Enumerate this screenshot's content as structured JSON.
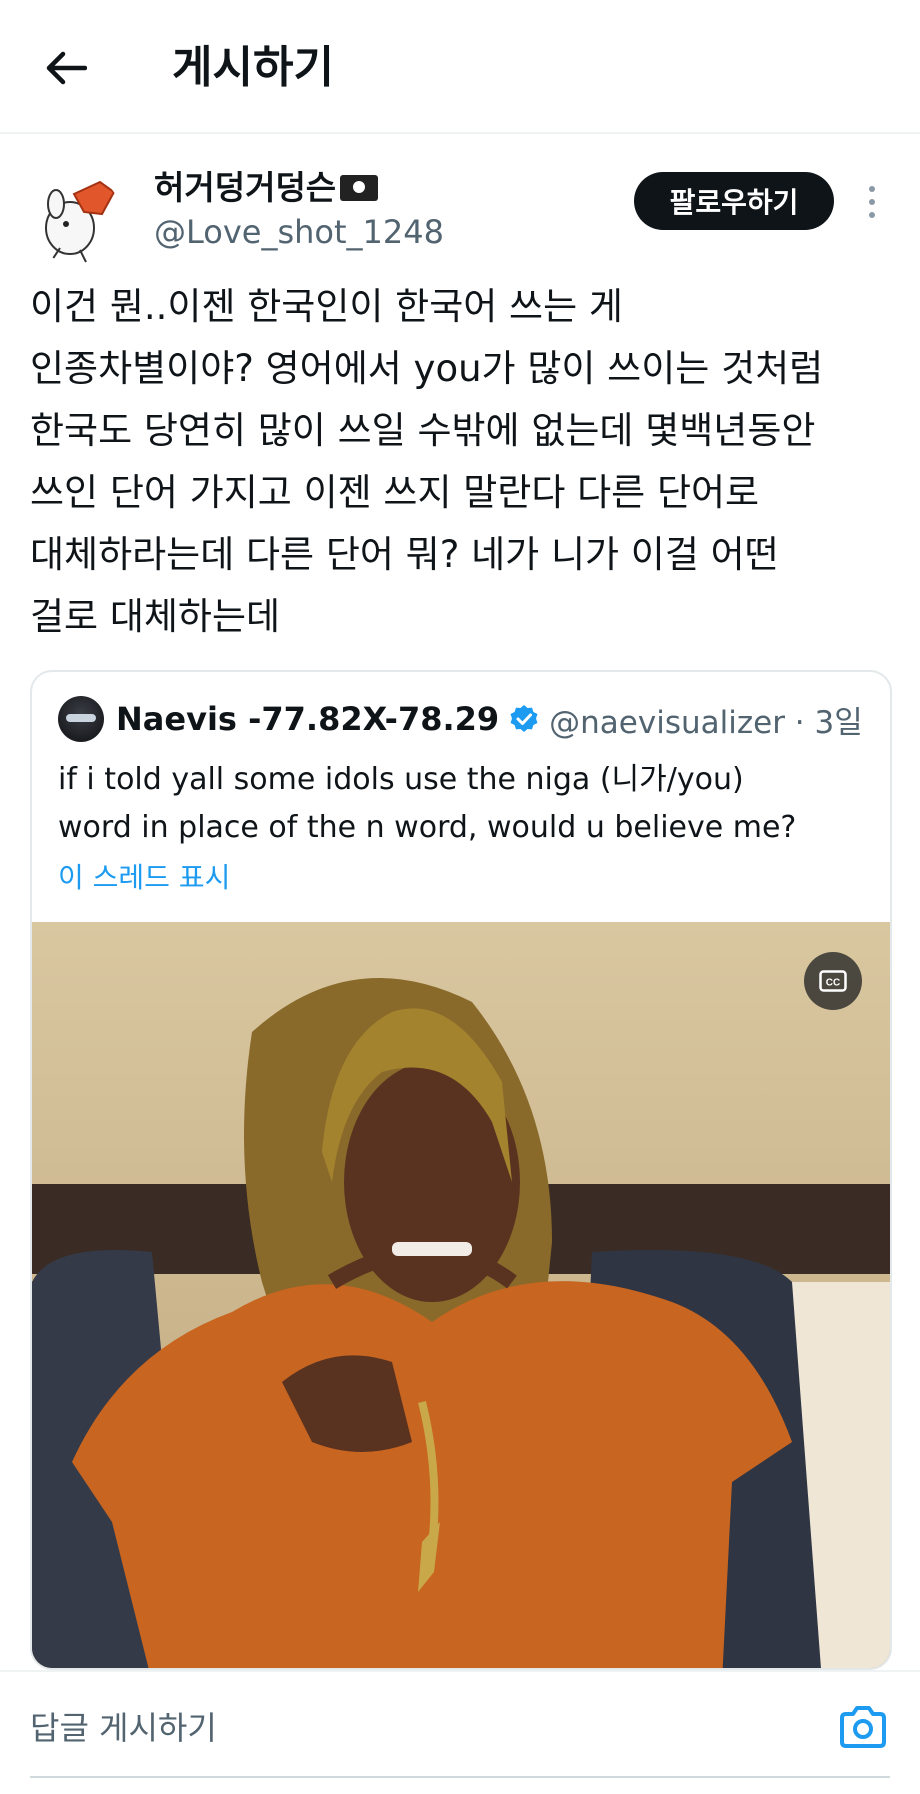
{
  "header": {
    "title": "게시하기",
    "back_icon": "arrow-left-icon"
  },
  "author": {
    "name": "허거덩거덩슨",
    "name_emoji": "pirate-flag-icon",
    "handle": "@Love_shot_1248",
    "follow_label": "팔로우하기",
    "more_icon": "more-vertical-icon"
  },
  "post": {
    "text": "이건 뭔..이젠 한국인이 한국어 쓰는 게\n인종차별이야? 영어에서 you가 많이 쓰이는 것처럼\n한국도 당연히 많이 쓰일 수밖에 없는데 몇백년동안\n쓰인 단어 가지고 이젠 쓰지 말란다 다른 단어로\n대체하라는데 다른 단어 뭐? 네가 니가 이걸 어떤\n걸로 대체하는데"
  },
  "quote": {
    "name": "Naevis -77.82X-78.29",
    "verified_icon": "verified-badge-icon",
    "handle": "@naevisualizer · 3일",
    "text": "if i told yall some idols use the niga (니가/you)\nword in place of the n word, would u believe me?",
    "thread_link": "이 스레드 표시",
    "media_cc_icon": "closed-captions-icon"
  },
  "reply": {
    "placeholder": "답글 게시하기",
    "camera_icon": "camera-icon"
  },
  "colors": {
    "accent": "#1d9bf0",
    "text": "#0f1419",
    "secondary": "#536471",
    "follow_bg": "#0f1419"
  }
}
